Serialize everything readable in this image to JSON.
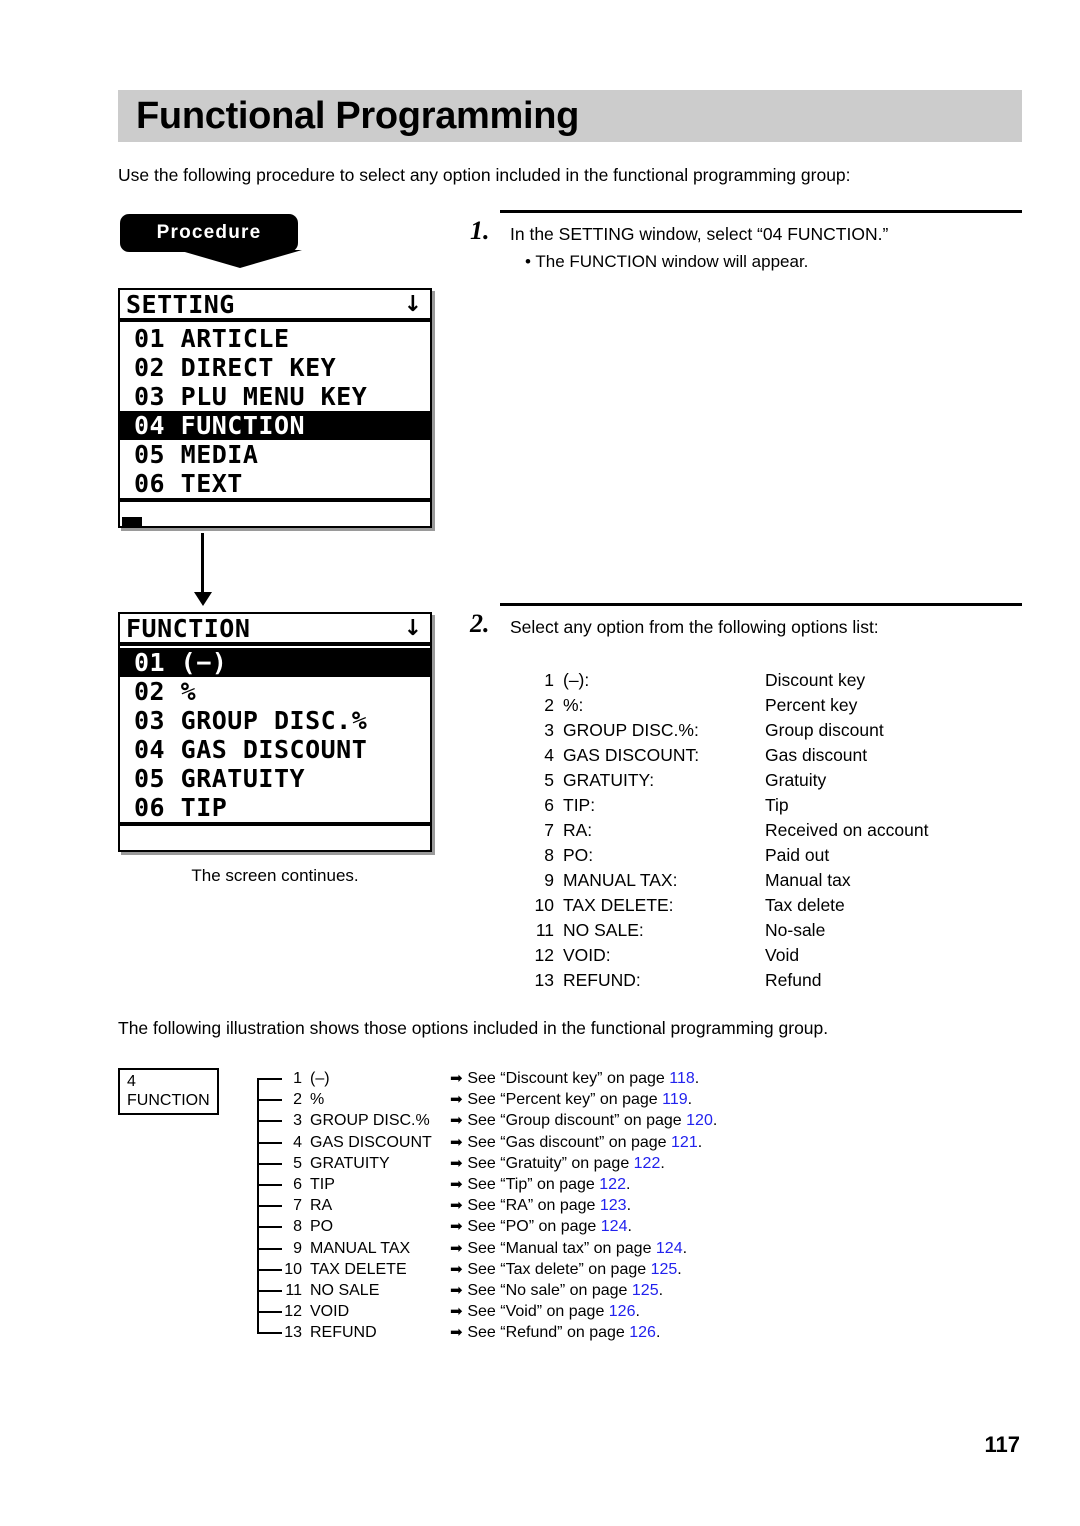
{
  "page": {
    "title": "Functional Programming",
    "intro": "Use the following procedure to select any option included in the functional programming group:",
    "bottom_note": "The following illustration shows those options included in the functional programming group.",
    "page_number": "117",
    "link_color": "#2222ee",
    "title_band_color": "#cccccc"
  },
  "procedure": {
    "badge_label": "Procedure",
    "caption": "The screen continues."
  },
  "steps": [
    {
      "number": "1.",
      "text": "In the SETTING window, select “04 FUNCTION.”",
      "bullet": "• The FUNCTION window will appear."
    },
    {
      "number": "2.",
      "text": "Select any option from the following options list:"
    }
  ],
  "lcd_setting": {
    "title": "SETTING",
    "scroll_icon": "down-arrow",
    "scroll_glyph": "↓",
    "rows": [
      {
        "num": "01",
        "label": "ARTICLE",
        "selected": false
      },
      {
        "num": "02",
        "label": "DIRECT KEY",
        "selected": false
      },
      {
        "num": "03",
        "label": "PLU MENU KEY",
        "selected": false
      },
      {
        "num": "04",
        "label": "FUNCTION",
        "selected": true
      },
      {
        "num": "05",
        "label": "MEDIA",
        "selected": false
      },
      {
        "num": "06",
        "label": "TEXT",
        "selected": false
      }
    ]
  },
  "lcd_function": {
    "title": "FUNCTION",
    "scroll_icon": "down-arrow",
    "scroll_glyph": "↓",
    "rows": [
      {
        "num": "01",
        "label": "(−)",
        "selected": true
      },
      {
        "num": "02",
        "label": "%",
        "selected": false
      },
      {
        "num": "03",
        "label": "GROUP DISC.%",
        "selected": false
      },
      {
        "num": "04",
        "label": "GAS DISCOUNT",
        "selected": false
      },
      {
        "num": "05",
        "label": "GRATUITY",
        "selected": false
      },
      {
        "num": "06",
        "label": "TIP",
        "selected": false
      }
    ]
  },
  "options_list": [
    {
      "idx": "1",
      "key": "(–):",
      "desc": "Discount key"
    },
    {
      "idx": "2",
      "key": "%:",
      "desc": "Percent key"
    },
    {
      "idx": "3",
      "key": "GROUP DISC.%:",
      "desc": "Group discount"
    },
    {
      "idx": "4",
      "key": "GAS DISCOUNT:",
      "desc": "Gas discount"
    },
    {
      "idx": "5",
      "key": "GRATUITY:",
      "desc": "Gratuity"
    },
    {
      "idx": "6",
      "key": "TIP:",
      "desc": "Tip"
    },
    {
      "idx": "7",
      "key": "RA:",
      "desc": "Received on account"
    },
    {
      "idx": "8",
      "key": "PO:",
      "desc": "Paid out"
    },
    {
      "idx": "9",
      "key": "MANUAL TAX:",
      "desc": "Manual tax"
    },
    {
      "idx": "10",
      "key": "TAX DELETE:",
      "desc": "Tax delete"
    },
    {
      "idx": "11",
      "key": "NO SALE:",
      "desc": "No-sale"
    },
    {
      "idx": "12",
      "key": "VOID:",
      "desc": "Void"
    },
    {
      "idx": "13",
      "key": "REFUND:",
      "desc": "Refund"
    }
  ],
  "tree": {
    "root_label": "4 FUNCTION",
    "arrow_glyph": "➡",
    "rows": [
      {
        "idx": "1",
        "key": "(–)",
        "see_prefix": "See “Discount key” on page ",
        "page": "118",
        "see_suffix": "."
      },
      {
        "idx": "2",
        "key": "%",
        "see_prefix": "See “Percent key” on page ",
        "page": "119",
        "see_suffix": "."
      },
      {
        "idx": "3",
        "key": "GROUP DISC.%",
        "see_prefix": "See “Group discount” on page ",
        "page": "120",
        "see_suffix": "."
      },
      {
        "idx": "4",
        "key": "GAS DISCOUNT",
        "see_prefix": "See “Gas discount” on page ",
        "page": "121",
        "see_suffix": "."
      },
      {
        "idx": "5",
        "key": "GRATUITY",
        "see_prefix": "See “Gratuity” on page ",
        "page": "122",
        "see_suffix": "."
      },
      {
        "idx": "6",
        "key": "TIP",
        "see_prefix": "See “Tip” on page ",
        "page": "122",
        "see_suffix": "."
      },
      {
        "idx": "7",
        "key": "RA",
        "see_prefix": "See “RA” on page ",
        "page": "123",
        "see_suffix": "."
      },
      {
        "idx": "8",
        "key": "PO",
        "see_prefix": "See “PO” on page ",
        "page": "124",
        "see_suffix": "."
      },
      {
        "idx": "9",
        "key": "MANUAL TAX",
        "see_prefix": "See “Manual tax” on page ",
        "page": "124",
        "see_suffix": "."
      },
      {
        "idx": "10",
        "key": "TAX DELETE",
        "see_prefix": "See “Tax delete” on page ",
        "page": "125",
        "see_suffix": "."
      },
      {
        "idx": "11",
        "key": "NO SALE",
        "see_prefix": "See “No sale” on page ",
        "page": "125",
        "see_suffix": "."
      },
      {
        "idx": "12",
        "key": "VOID",
        "see_prefix": "See “Void” on page ",
        "page": "126",
        "see_suffix": "."
      },
      {
        "idx": "13",
        "key": "REFUND",
        "see_prefix": "See “Refund” on page ",
        "page": "126",
        "see_suffix": "."
      }
    ]
  }
}
